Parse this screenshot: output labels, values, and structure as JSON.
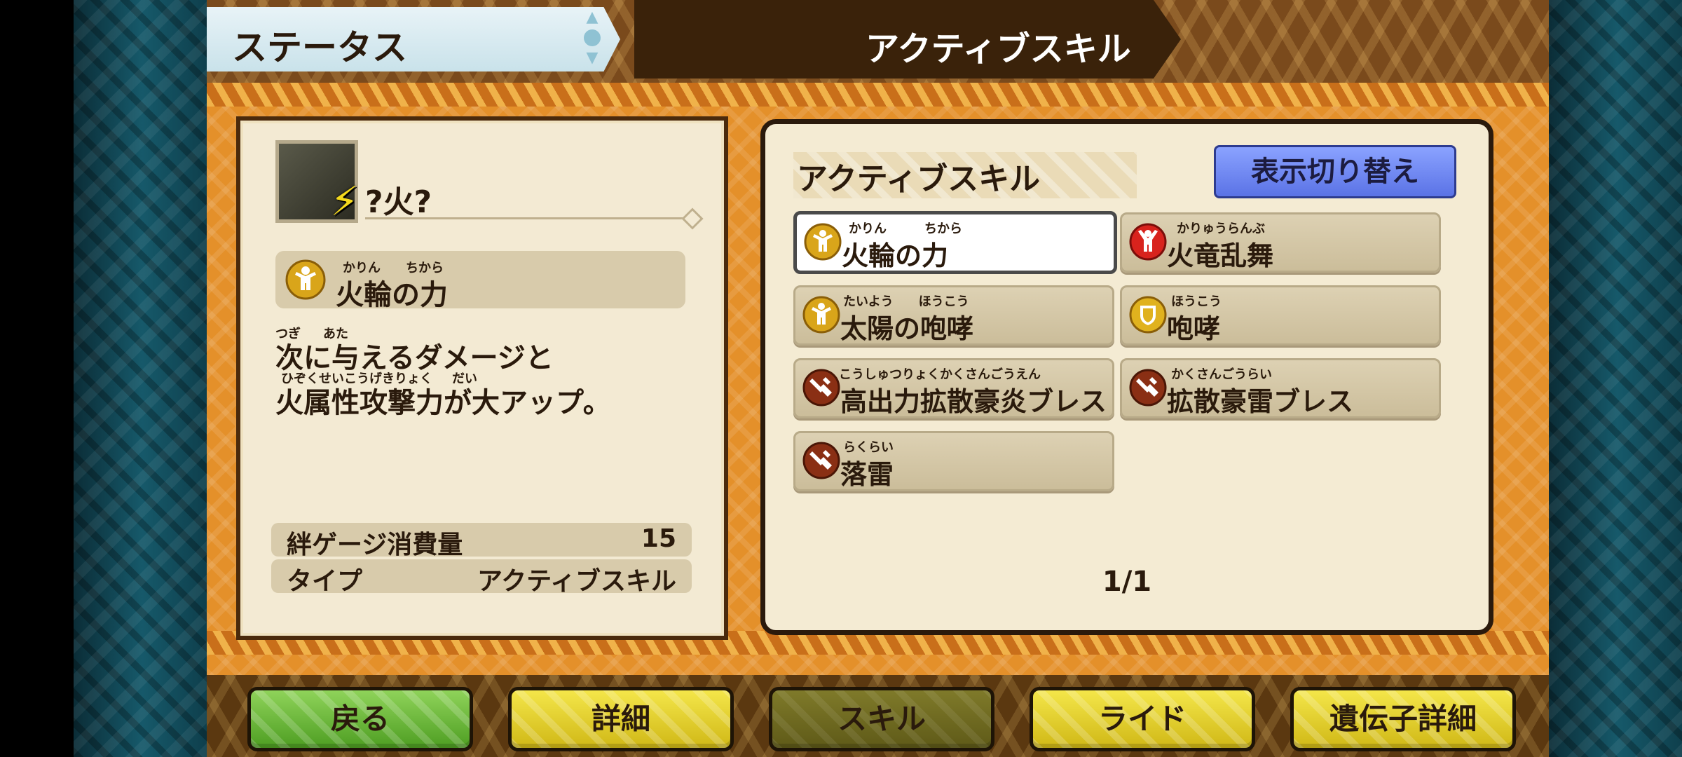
{
  "header": {
    "tab_status": "ステータス",
    "tab_active": "アクティブスキル"
  },
  "monster": {
    "name": "?火?",
    "element_icon": "lightning-bolt-icon"
  },
  "selected_skill": {
    "ruby_1": "かりん",
    "ruby_2": "ちから",
    "name": "火輪の力",
    "description": {
      "line1_ruby_a": "つぎ",
      "line1_ruby_b": "あた",
      "line1": "次に与えるダメージと",
      "line2_ruby_a": "ひぞくせいこうげきりょく",
      "line2_ruby_b": "だい",
      "line2": "火属性攻撃力が大アップ。"
    },
    "stats": {
      "gauge_label": "絆ゲージ消費量",
      "gauge_value": "15",
      "type_label": "タイプ",
      "type_value": "アクティブスキル"
    }
  },
  "skill_list": {
    "title": "アクティブスキル",
    "switch_button": "表示切り替え",
    "items": [
      {
        "ruby": "かりん　　　ちから",
        "name": "火輪の力",
        "icon": "power-up-yellow-icon",
        "active": true
      },
      {
        "ruby": "かりゅうらんぶ",
        "name": "火竜乱舞",
        "icon": "power-up-red-icon",
        "active": false
      },
      {
        "ruby": "たいよう　　ほうこう",
        "name": "太陽の咆哮",
        "icon": "power-up-yellow-icon",
        "active": false
      },
      {
        "ruby": "ほうこう",
        "name": "咆哮",
        "icon": "shield-yellow-icon",
        "active": false
      },
      {
        "ruby": "こうしゅつりょくかくさんごうえん",
        "name": "高出力拡散豪炎ブレス",
        "icon": "attack-brown-icon",
        "active": false
      },
      {
        "ruby": "かくさんごうらい",
        "name": "拡散豪雷ブレス",
        "icon": "attack-brown-icon",
        "active": false
      },
      {
        "ruby": "らくらい",
        "name": "落雷",
        "icon": "attack-brown-icon",
        "active": false
      }
    ],
    "page": "1/1"
  },
  "nav": {
    "back": "戻る",
    "detail": "詳細",
    "skill": "スキル",
    "ride": "ライド",
    "gene_detail": "遺伝子詳細"
  },
  "colors": {
    "accent_blue": "#6b83f0",
    "band_orange": "#e4902a",
    "nav_green": "#6cbf3a",
    "nav_yellow": "#e8d530"
  }
}
